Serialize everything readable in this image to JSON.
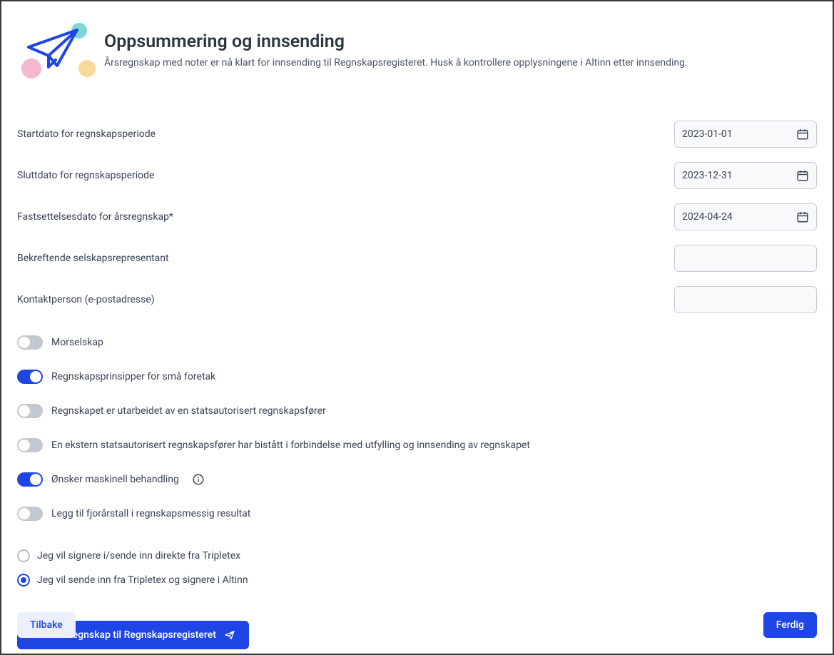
{
  "header": {
    "title": "Oppsummering og innsending",
    "subtitle": "Årsregnskap med noter er nå klart for innsending til Regnskapsregisteret. Husk å kontrollere opplysningene i Altinn etter innsending."
  },
  "fields": {
    "start_date": {
      "label": "Startdato for regnskapsperiode",
      "value": "2023-01-01"
    },
    "end_date": {
      "label": "Sluttdato for regnskapsperiode",
      "value": "2023-12-31"
    },
    "approval_date": {
      "label": "Fastsettelsesdato for årsregnskap*",
      "value": "2024-04-24"
    },
    "representative": {
      "label": "Bekreftende selskapsrepresentant",
      "value": ""
    },
    "contact": {
      "label": "Kontaktperson (e-postadresse)",
      "value": ""
    }
  },
  "toggles": {
    "parent_company": {
      "label": "Morselskap",
      "on": false
    },
    "small_principles": {
      "label": "Regnskapsprinsipper for små foretak",
      "on": true
    },
    "auth_accountant": {
      "label": "Regnskapet er utarbeidet av en statsautorisert regnskapsfører",
      "on": false
    },
    "external_accountant": {
      "label": "En ekstern statsautorisert regnskapsfører har bistått i forbindelse med utfylling og innsending av regnskapet",
      "on": false
    },
    "machine_processing": {
      "label": "Ønsker maskinell behandling",
      "on": true
    },
    "prev_year": {
      "label": "Legg til fjorårstall i regnskapsmessig resultat",
      "on": false
    }
  },
  "radios": {
    "sign_tripletex": {
      "label": "Jeg vil signere i/sende inn direkte fra Tripletex",
      "checked": false
    },
    "sign_altinn": {
      "label": "Jeg vil sende inn fra Tripletex og signere i Altinn",
      "checked": true
    }
  },
  "buttons": {
    "send": "Send årsregnskap til Regnskapsregisteret",
    "back": "Tilbake",
    "done": "Ferdig"
  }
}
